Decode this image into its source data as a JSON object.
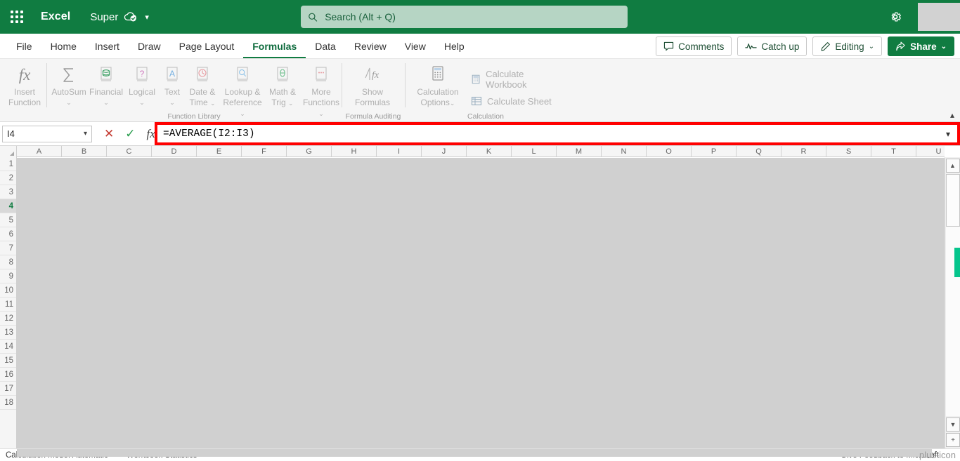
{
  "titlebar": {
    "app_name": "Excel",
    "doc_name": "Super",
    "waffle_icon": "app-launcher-icon",
    "cloud_icon": "cloud-saved-icon",
    "doc_chevron_icon": "chevron-down-icon",
    "settings_icon": "gear-icon",
    "brand_color": "#107c41"
  },
  "search": {
    "placeholder": "Search (Alt + Q)",
    "value": "",
    "icon": "search-icon"
  },
  "tabs": [
    {
      "label": "File",
      "active": false
    },
    {
      "label": "Home",
      "active": false
    },
    {
      "label": "Insert",
      "active": false
    },
    {
      "label": "Draw",
      "active": false
    },
    {
      "label": "Page Layout",
      "active": false
    },
    {
      "label": "Formulas",
      "active": true
    },
    {
      "label": "Data",
      "active": false
    },
    {
      "label": "Review",
      "active": false
    },
    {
      "label": "View",
      "active": false
    },
    {
      "label": "Help",
      "active": false
    }
  ],
  "tab_actions": {
    "comments": {
      "label": "Comments",
      "icon": "comment-icon"
    },
    "catch_up": {
      "label": "Catch up",
      "icon": "activity-icon"
    },
    "editing": {
      "label": "Editing",
      "icon": "pencil-icon",
      "chevron": "⌄"
    },
    "share": {
      "label": "Share",
      "icon": "share-icon",
      "chevron": "⌄"
    }
  },
  "ribbon": {
    "collapse_icon": "chevron-up-icon",
    "groups": [
      {
        "name": "insert-function",
        "label": "",
        "items": [
          {
            "label": "Insert\nFunction",
            "label_line1": "Insert",
            "label_line2": "Function",
            "icon": "fx-icon",
            "chevron": ""
          }
        ]
      },
      {
        "name": "function-library",
        "label": "Function Library",
        "items": [
          {
            "label_line1": "AutoSum",
            "label_line2": "",
            "icon": "sigma-icon",
            "chevron": "⌄"
          },
          {
            "label_line1": "Financial",
            "label_line2": "",
            "icon": "financial-book-icon",
            "chevron": "⌄"
          },
          {
            "label_line1": "Logical",
            "label_line2": "",
            "icon": "logical-book-icon",
            "chevron": "⌄"
          },
          {
            "label_line1": "Text",
            "label_line2": "",
            "icon": "text-book-icon",
            "chevron": "⌄"
          },
          {
            "label_line1": "Date &",
            "label_line2": "Time",
            "icon": "date-time-book-icon",
            "chevron": "⌄"
          },
          {
            "label_line1": "Lookup &",
            "label_line2": "Reference",
            "icon": "lookup-book-icon",
            "chevron": "⌄"
          },
          {
            "label_line1": "Math &",
            "label_line2": "Trig",
            "icon": "math-book-icon",
            "chevron": "⌄"
          },
          {
            "label_line1": "More",
            "label_line2": "Functions",
            "icon": "more-functions-book-icon",
            "chevron": "⌄"
          }
        ]
      },
      {
        "name": "formula-auditing",
        "label": "Formula Auditing",
        "items": [
          {
            "label_line1": "Show",
            "label_line2": "Formulas",
            "icon": "show-formulas-icon",
            "chevron": ""
          }
        ]
      },
      {
        "name": "calculation",
        "label": "Calculation",
        "items": [
          {
            "label_line1": "Calculation",
            "label_line2": "Options",
            "icon": "calculator-icon",
            "chevron": "⌄"
          }
        ],
        "list_items": [
          {
            "label": "Calculate Workbook",
            "icon": "calculate-workbook-icon"
          },
          {
            "label": "Calculate Sheet",
            "icon": "calculate-sheet-icon"
          }
        ]
      }
    ]
  },
  "formula_bar": {
    "name_box_value": "I4",
    "name_box_chevron": "chevron-down-icon",
    "cancel_icon": "cancel-x-icon",
    "confirm_icon": "confirm-check-icon",
    "insert_function_icon": "fx-icon",
    "formula_value": "=AVERAGE(I2:I3)",
    "expand_icon": "chevron-down-icon",
    "highlight_color": "#ff0000"
  },
  "grid": {
    "columns": [
      "A",
      "B",
      "C",
      "D",
      "E",
      "F",
      "G",
      "H",
      "I",
      "J",
      "K",
      "L",
      "M",
      "N",
      "O",
      "P",
      "Q",
      "R",
      "S",
      "T",
      "U"
    ],
    "rows": [
      "1",
      "2",
      "3",
      "4",
      "5",
      "6",
      "7",
      "8",
      "9",
      "10",
      "11",
      "12",
      "13",
      "14",
      "15",
      "16",
      "17",
      "18"
    ],
    "selected_row": "4",
    "select_all_icon": "select-all-corner-icon",
    "scrollbar": {
      "up_icon": "▲",
      "down_icon": "▼",
      "add_icon": "+",
      "accent_color": "#05c58c"
    }
  },
  "status_bar": {
    "left_items": [
      "Calculation mode: Automatic",
      "Workbook Statistics"
    ],
    "right_items": [
      "Give Feedback to Microsoft"
    ],
    "add_icon": "plus-icon"
  }
}
